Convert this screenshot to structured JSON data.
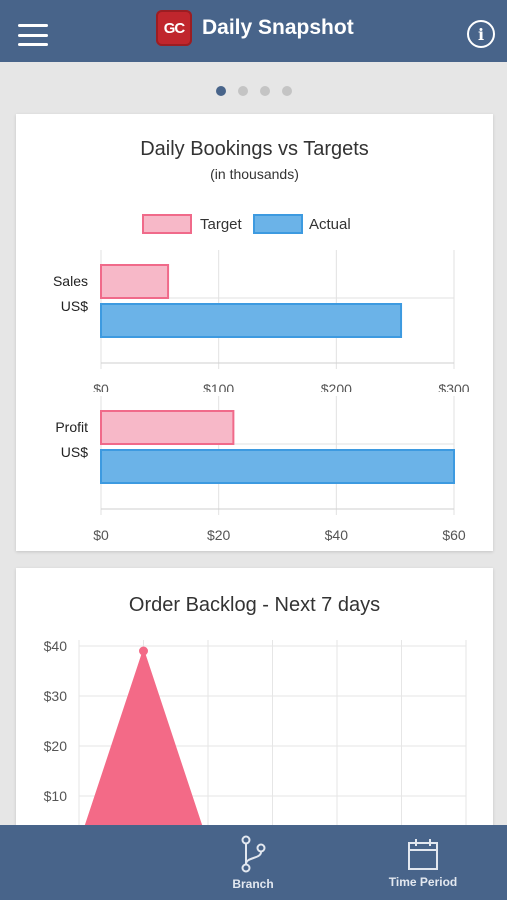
{
  "header": {
    "logo_text": "GC",
    "title": "Daily Snapshot",
    "info_label": "i"
  },
  "pager": {
    "pages": 4,
    "active_index": 0
  },
  "colors": {
    "header": "#48648a",
    "target_fill": "#f7b8c8",
    "target_stroke": "#f06a8a",
    "actual_fill": "#6bb3e8",
    "actual_stroke": "#3d9ae0",
    "backlog_fill": "#f36a87"
  },
  "bookings_card": {
    "title": "Daily Bookings vs Targets",
    "subtitle": "(in thousands)",
    "legend": [
      "Target",
      "Actual"
    ]
  },
  "backlog_card": {
    "title": "Order Backlog - Next 7 days"
  },
  "footer": {
    "items": [
      {
        "label": "Branch",
        "icon": "branch-icon"
      },
      {
        "label": "Time Period",
        "icon": "calendar-icon"
      }
    ]
  },
  "chart_data": [
    {
      "type": "bar",
      "orientation": "horizontal",
      "title": "Daily Bookings vs Targets",
      "subtitle": "(in thousands)",
      "categories": [
        "Sales",
        "US$"
      ],
      "series": [
        {
          "name": "Target",
          "values": [
            57
          ]
        },
        {
          "name": "Actual",
          "values": [
            255
          ]
        }
      ],
      "xlim": [
        0,
        300
      ],
      "ticks": [
        "$0",
        "$100",
        "$200",
        "$300"
      ],
      "tick_values": [
        0,
        100,
        200,
        300
      ],
      "grid": true,
      "legend": "top"
    },
    {
      "type": "bar",
      "orientation": "horizontal",
      "categories": [
        "Profit",
        "US$"
      ],
      "series": [
        {
          "name": "Target",
          "values": [
            22.5
          ]
        },
        {
          "name": "Actual",
          "values": [
            60
          ]
        }
      ],
      "xlim": [
        0,
        60
      ],
      "ticks": [
        "$0",
        "$20",
        "$40",
        "$60"
      ],
      "tick_values": [
        0,
        20,
        40,
        60
      ],
      "grid": true,
      "legend": "top"
    },
    {
      "type": "area",
      "title": "Order Backlog - Next 7 days",
      "points_y": [
        0,
        39,
        0,
        0,
        0,
        0,
        0
      ],
      "ylim": [
        0,
        40
      ],
      "ticks": [
        "$10",
        "$20",
        "$30",
        "$40"
      ],
      "tick_values": [
        10,
        20,
        30,
        40
      ],
      "grid": true
    }
  ]
}
